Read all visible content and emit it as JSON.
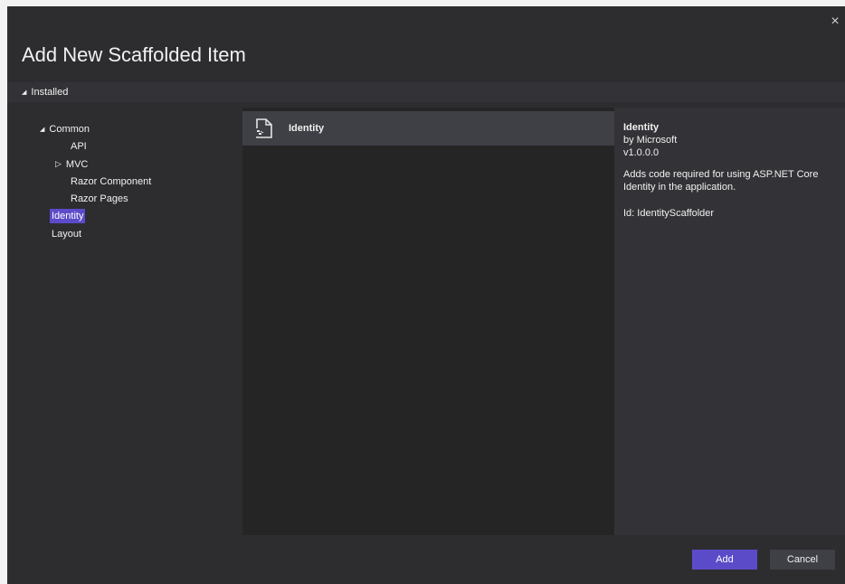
{
  "dialog": {
    "title": "Add New Scaffolded Item",
    "close_glyph": "×"
  },
  "installed": {
    "label": "Installed",
    "expanded": true
  },
  "tree": {
    "common": {
      "label": "Common",
      "expanded": true
    },
    "api": {
      "label": "API"
    },
    "mvc": {
      "label": "MVC",
      "expanded": false
    },
    "razor_component": {
      "label": "Razor Component"
    },
    "razor_pages": {
      "label": "Razor Pages"
    },
    "identity": {
      "label": "Identity",
      "selected": true
    },
    "layout": {
      "label": "Layout"
    }
  },
  "templates": [
    {
      "label": "Identity",
      "icon": "scaffold-file-icon",
      "selected": true
    }
  ],
  "details": {
    "title": "Identity",
    "author": "by Microsoft",
    "version": "v1.0.0.0",
    "description": "Adds code required for using ASP.NET Core Identity in the application.",
    "id": "Id: IdentityScaffolder"
  },
  "footer": {
    "add_label": "Add",
    "cancel_label": "Cancel"
  },
  "colors": {
    "accent": "#5c4bc9",
    "background": "#2d2d30",
    "list_background": "#252526",
    "selected_item": "#3f3f46"
  }
}
